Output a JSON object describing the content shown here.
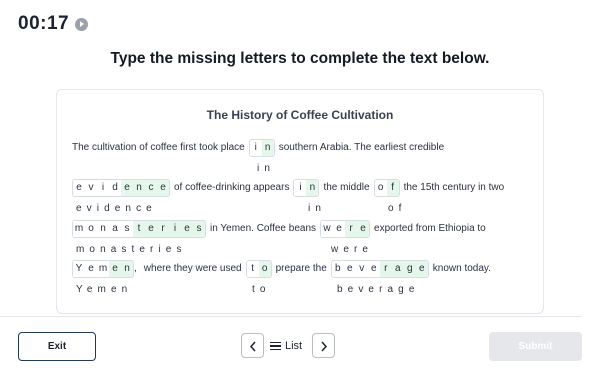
{
  "timer": "00:17",
  "instruction": "Type the missing letters to complete the text below.",
  "passage_title": "The History of Coffee Cultivation",
  "text": {
    "l1_a": "The cultivation of coffee first took place",
    "l1_b": "southern Arabia. The earliest credible",
    "l2_a": "of coffee-drinking appears",
    "l2_b": "the middle",
    "l2_c": "the 15th century in two",
    "l3_a": "in Yemen. Coffee beans",
    "l3_b": "exported from Ethiopia to",
    "l4_a": ",",
    "l4_b": "where they were used",
    "l4_c": "prepare the",
    "l4_d": "known today."
  },
  "gaps": [
    {
      "letters": [
        "i",
        "n"
      ],
      "hints": [
        false,
        true
      ],
      "answer": "in"
    },
    {
      "letters": [
        "e",
        "v",
        "i",
        "d",
        "e",
        "n",
        "c",
        "e"
      ],
      "hints": [
        false,
        false,
        false,
        false,
        true,
        true,
        true,
        true
      ],
      "answer": "evidence"
    },
    {
      "letters": [
        "i",
        "n"
      ],
      "hints": [
        false,
        true
      ],
      "answer": "in"
    },
    {
      "letters": [
        "o",
        "f"
      ],
      "hints": [
        false,
        true
      ],
      "answer": "of"
    },
    {
      "letters": [
        "m",
        "o",
        "n",
        "a",
        "s",
        "t",
        "e",
        "r",
        "i",
        "e",
        "s"
      ],
      "hints": [
        false,
        false,
        false,
        false,
        false,
        true,
        true,
        true,
        true,
        true,
        true
      ],
      "answer": "monasteries"
    },
    {
      "letters": [
        "w",
        "e",
        "r",
        "e"
      ],
      "hints": [
        false,
        false,
        true,
        true
      ],
      "answer": "were"
    },
    {
      "letters": [
        "Y",
        "e",
        "m",
        "e",
        "n"
      ],
      "hints": [
        false,
        false,
        false,
        true,
        true
      ],
      "answer": "Yemen"
    },
    {
      "letters": [
        "t",
        "o"
      ],
      "hints": [
        false,
        true
      ],
      "answer": "to"
    },
    {
      "letters": [
        "b",
        "e",
        "v",
        "e",
        "r",
        "a",
        "g",
        "e"
      ],
      "hints": [
        false,
        false,
        false,
        false,
        true,
        true,
        true,
        true
      ],
      "answer": "beverage"
    }
  ],
  "footer": {
    "exit_label": "Exit",
    "list_label": "List",
    "submit_label": "Submit"
  },
  "colors": {
    "hint_fill": "#e5f6ea",
    "exit_border": "#1f3b57",
    "submit_disabled": "#e5e7eb"
  },
  "icons": {
    "timer": "play-circle-icon",
    "prev": "chevron-left-icon",
    "next": "chevron-right-icon",
    "list": "list-icon"
  }
}
